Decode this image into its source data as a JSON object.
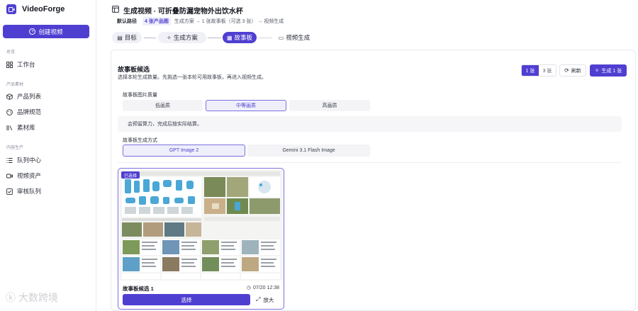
{
  "sidebar": {
    "brand": "VideoForge",
    "create_label": "创建视频",
    "sections": [
      {
        "label": "总览",
        "items": [
          {
            "label": "工作台",
            "icon": "home-icon"
          }
        ]
      },
      {
        "label": "产品素材",
        "items": [
          {
            "label": "产品列表",
            "icon": "box-icon"
          },
          {
            "label": "品牌规范",
            "icon": "palette-icon"
          },
          {
            "label": "素材库",
            "icon": "library-icon"
          }
        ]
      },
      {
        "label": "内容生产",
        "items": [
          {
            "label": "队列中心",
            "icon": "list-icon"
          },
          {
            "label": "视频资产",
            "icon": "video-icon"
          },
          {
            "label": "审核队列",
            "icon": "checkbox-icon"
          }
        ]
      }
    ]
  },
  "header": {
    "title": "生成视频 · 可折叠防漏宠物外出饮水杯",
    "path_label": "默认路径",
    "path_badge": "4 张产品图",
    "path_flow": "生成方案 → 1 张故事板（可选 3 张） → 视频生成"
  },
  "steps": [
    {
      "label": "目标",
      "state": "done"
    },
    {
      "label": "生成方案",
      "state": "done"
    },
    {
      "label": "故事板",
      "state": "active"
    },
    {
      "label": "视频生成",
      "state": "todo"
    }
  ],
  "storyboard": {
    "title": "故事板候选",
    "subtitle": "选择本轮生成数量。先挑选一张本轮可用故事板，再进入视频生成。",
    "count_options": [
      "1 张",
      "3 张"
    ],
    "count_selected": "1 张",
    "refresh_label": "刷新",
    "generate_label": "生成 1 张",
    "quality_label": "故事板图片质量",
    "quality_options": [
      "低画质",
      "中等画质",
      "高画质"
    ],
    "quality_selected": "中等画质",
    "quality_note": "会预留算力，完成后按实际结算。",
    "method_label": "故事板生成方式",
    "method_options": [
      "GPT Image 2",
      "Gemini 3.1 Flash Image"
    ],
    "method_selected": "GPT Image 2",
    "candidates": [
      {
        "badge": "已选择",
        "name": "故事板候选 1",
        "time": "07/20 12:38",
        "choose_label": "选择",
        "zoom_label": "放大"
      }
    ]
  },
  "watermark": "大数跨境",
  "colors": {
    "accent": "#4f3fd1",
    "accent_soft": "#efeffb",
    "border": "#e9e9ef"
  }
}
